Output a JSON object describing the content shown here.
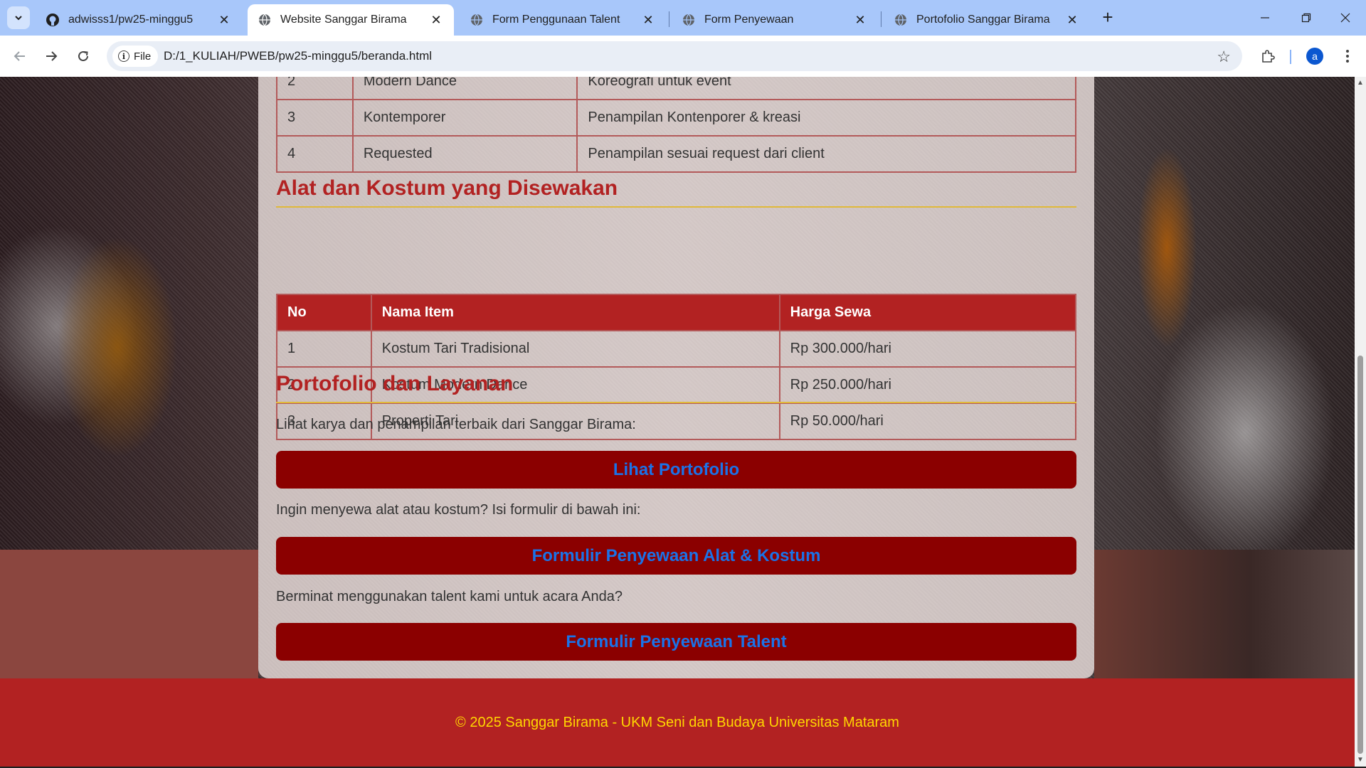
{
  "browser": {
    "tabs": [
      {
        "label": "adwisss1/pw25-minggu5",
        "icon": "github-icon",
        "active": false
      },
      {
        "label": "Website Sanggar Birama",
        "icon": "globe-icon",
        "active": true
      },
      {
        "label": "Form Penggunaan Talent",
        "icon": "globe-icon",
        "active": false
      },
      {
        "label": "Form Penyewaan",
        "icon": "globe-icon",
        "active": false
      },
      {
        "label": "Portofolio Sanggar Birama",
        "icon": "globe-icon",
        "active": false
      }
    ],
    "file_chip": "File",
    "url": "D:/1_KULIAH/PWEB/pw25-minggu5/beranda.html",
    "profile_initial": "a",
    "accent_color": "#a8c7fa"
  },
  "page": {
    "services_table": {
      "rows": [
        {
          "no": "2",
          "name": "Modern Dance",
          "desc": "Koreografi untuk event"
        },
        {
          "no": "3",
          "name": "Kontemporer",
          "desc": "Penampilan Kontenporer & kreasi"
        },
        {
          "no": "4",
          "name": "Requested",
          "desc": "Penampilan sesuai request dari client"
        }
      ]
    },
    "rental": {
      "title": "Alat dan Kostum yang Disewakan",
      "headers": {
        "no": "No",
        "name": "Nama Item",
        "price": "Harga Sewa"
      },
      "rows": [
        {
          "no": "1",
          "name": "Kostum Tari Tradisional",
          "price": "Rp 300.000/hari"
        },
        {
          "no": "2",
          "name": "Kostum Modern Dance",
          "price": "Rp 250.000/hari"
        },
        {
          "no": "3",
          "name": "Properti Tari",
          "price": "Rp 50.000/hari"
        }
      ]
    },
    "portfolio": {
      "title": "Portofolio dan Layanan",
      "intro": "Lihat karya dan penampilan terbaik dari Sanggar Birama:",
      "portfolio_button": "Lihat Portofolio",
      "rent_text": "Ingin menyewa alat atau kostum? Isi formulir di bawah ini:",
      "rent_button": "Formulir Penyewaan Alat & Kostum",
      "talent_text": "Berminat menggunakan talent kami untuk acara Anda?",
      "talent_button": "Formulir Penyewaan Talent"
    },
    "footer": "© 2025 Sanggar Birama - UKM Seni dan Budaya Universitas Mataram",
    "colors": {
      "primary_red": "#b22222",
      "button_dark_red": "#8b0000",
      "button_text_blue": "#1a73e8",
      "footer_text_gold": "#ffd700",
      "heading_rule_gold": "#e0b93a"
    }
  }
}
